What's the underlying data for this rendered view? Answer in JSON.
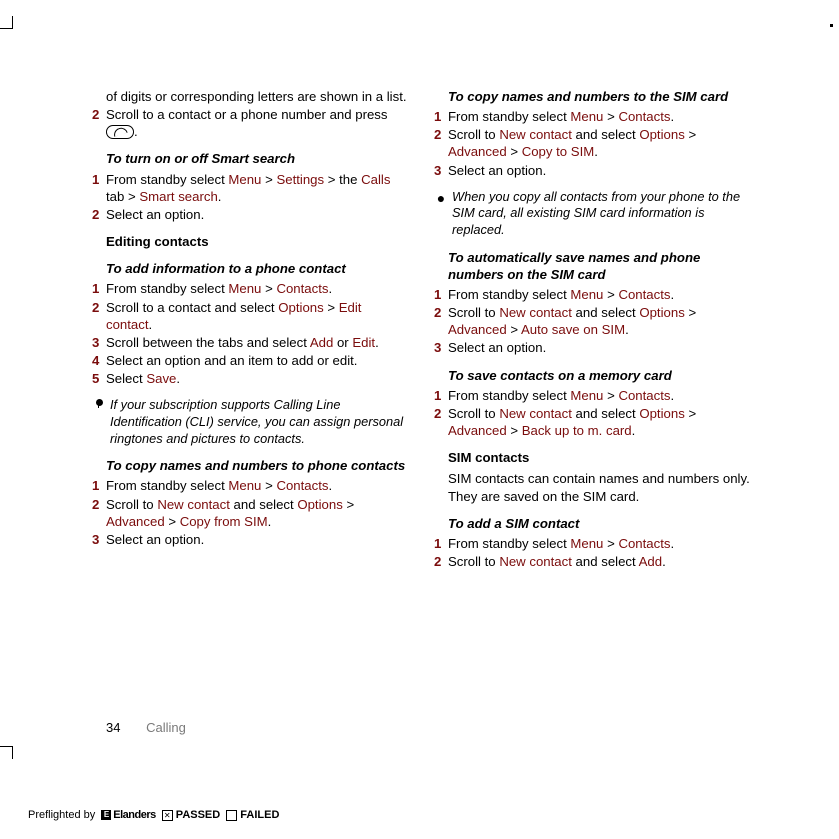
{
  "page": {
    "number": "34",
    "section": "Calling"
  },
  "left": {
    "intro1": "of digits or corresponding letters are shown in a list.",
    "step2_a": "Scroll to a contact or a phone number and press ",
    "step2_b": ".",
    "h_smart": "To turn on or off Smart search",
    "smart": {
      "s1_a": "From standby select ",
      "s1_m": "Menu",
      "s1_b": " > ",
      "s1_set": "Settings",
      "s1_c": " > the ",
      "s1_calls": "Calls",
      "s1_d": " tab > ",
      "s1_ss": "Smart search",
      "s1_e": ".",
      "s2": "Select an option."
    },
    "h_edit": "Editing contacts",
    "h_addinfo": "To add information to a phone contact",
    "addinfo": {
      "s1_a": "From standby select ",
      "s1_m": "Menu",
      "s1_b": " > ",
      "s1_c": "Contacts",
      "s1_d": ".",
      "s2_a": "Scroll to a contact and select ",
      "s2_o": "Options",
      "s2_b": " > ",
      "s2_e": "Edit contact",
      "s2_c": ".",
      "s3_a": "Scroll between the tabs and select ",
      "s3_add": "Add",
      "s3_b": " or ",
      "s3_edit": "Edit",
      "s3_c": ".",
      "s4": "Select an option and an item to add or edit.",
      "s5_a": "Select ",
      "s5_s": "Save",
      "s5_b": "."
    },
    "tip1": "If your subscription supports Calling Line Identification (CLI) service, you can assign personal ringtones and pictures to contacts.",
    "h_copyto": "To copy names and numbers to phone contacts",
    "copyto": {
      "s1_a": "From standby select ",
      "s1_m": "Menu",
      "s1_b": " > ",
      "s1_c": "Contacts",
      "s1_d": ".",
      "s2_a": "Scroll to ",
      "s2_n": "New contact",
      "s2_b": " and select ",
      "s2_o": "Options",
      "s2_c": " > ",
      "s2_adv": "Advanced",
      "s2_d": " > ",
      "s2_cp": "Copy from SIM",
      "s2_e": ".",
      "s3": "Select an option."
    }
  },
  "right": {
    "h_copysim": "To copy names and numbers to the SIM card",
    "copysim": {
      "s1_a": "From standby select ",
      "s1_m": "Menu",
      "s1_b": " > ",
      "s1_c": "Contacts",
      "s1_d": ".",
      "s2_a": "Scroll to ",
      "s2_n": "New contact",
      "s2_b": " and select ",
      "s2_o": "Options",
      "s2_c": " > ",
      "s2_adv": "Advanced",
      "s2_d": " > ",
      "s2_cp": "Copy to SIM",
      "s2_e": ".",
      "s3": "Select an option."
    },
    "warn": "When you copy all contacts from your phone to the SIM card, all existing SIM card information is replaced.",
    "h_autosave": "To automatically save names and phone numbers on the SIM card",
    "autosave": {
      "s1_a": "From standby select ",
      "s1_m": "Menu",
      "s1_b": " > ",
      "s1_c": "Contacts",
      "s1_d": ".",
      "s2_a": "Scroll to ",
      "s2_n": "New contact",
      "s2_b": " and select ",
      "s2_o": "Options",
      "s2_c": " > ",
      "s2_adv": "Advanced",
      "s2_d": " > ",
      "s2_as": "Auto save on SIM",
      "s2_e": ".",
      "s3": "Select an option."
    },
    "h_savemem": "To save contacts on a memory card",
    "savemem": {
      "s1_a": "From standby select ",
      "s1_m": "Menu",
      "s1_b": " > ",
      "s1_c": "Contacts",
      "s1_d": ".",
      "s2_a": "Scroll to ",
      "s2_n": "New contact",
      "s2_b": " and select ",
      "s2_o": "Options",
      "s2_c": " > ",
      "s2_adv": "Advanced",
      "s2_d": " > ",
      "s2_bk": "Back up to m. card",
      "s2_e": "."
    },
    "h_simc": "SIM contacts",
    "simc_body": "SIM contacts can contain names and numbers only. They are saved on the SIM card.",
    "h_addsim": "To add a SIM contact",
    "addsim": {
      "s1_a": "From standby select ",
      "s1_m": "Menu",
      "s1_b": " > ",
      "s1_c": "Contacts",
      "s1_d": ".",
      "s2_a": "Scroll to ",
      "s2_n": "New contact",
      "s2_b": " and select ",
      "s2_add": "Add",
      "s2_c": "."
    }
  },
  "preflight": {
    "label": "Preflighted by",
    "brand": "Elanders",
    "passed": "PASSED",
    "failed": "FAILED"
  },
  "nums": {
    "n1": "1",
    "n2": "2",
    "n3": "3",
    "n4": "4",
    "n5": "5"
  }
}
